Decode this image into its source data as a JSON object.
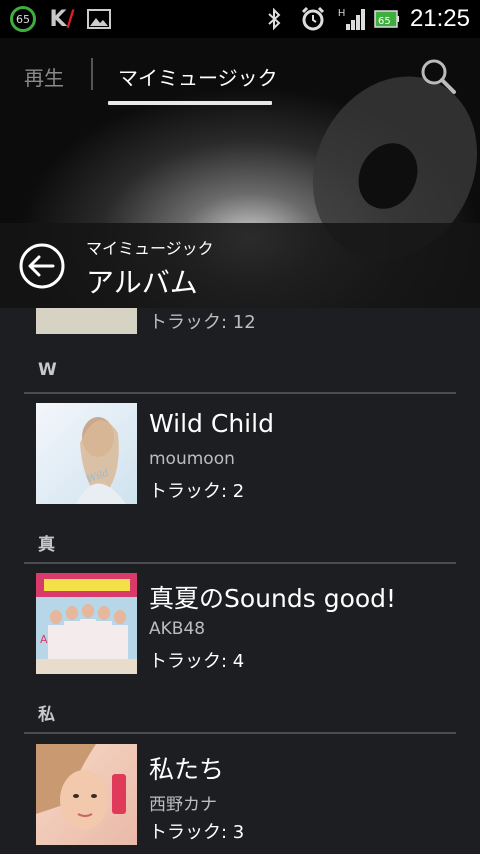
{
  "status_bar": {
    "badge": "65",
    "time": "21:25",
    "battery": "65",
    "network": "H"
  },
  "tabs": [
    {
      "label": "再生"
    },
    {
      "label": "マイミュージック"
    }
  ],
  "titlebar": {
    "breadcrumb": "マイミュージック",
    "title": "アルバム"
  },
  "partial_row": {
    "tracks": "トラック: 12"
  },
  "sections": [
    {
      "header": "W",
      "albums": [
        {
          "title": "Wild Child",
          "artist": "moumoon",
          "tracks": "トラック: 2"
        }
      ]
    },
    {
      "header": "真",
      "albums": [
        {
          "title": "真夏のSounds good!",
          "artist": "AKB48",
          "tracks": "トラック: 4"
        }
      ]
    },
    {
      "header": "私",
      "albums": [
        {
          "title": "私たち",
          "artist": "西野カナ",
          "tracks": "トラック: 3"
        }
      ]
    }
  ]
}
